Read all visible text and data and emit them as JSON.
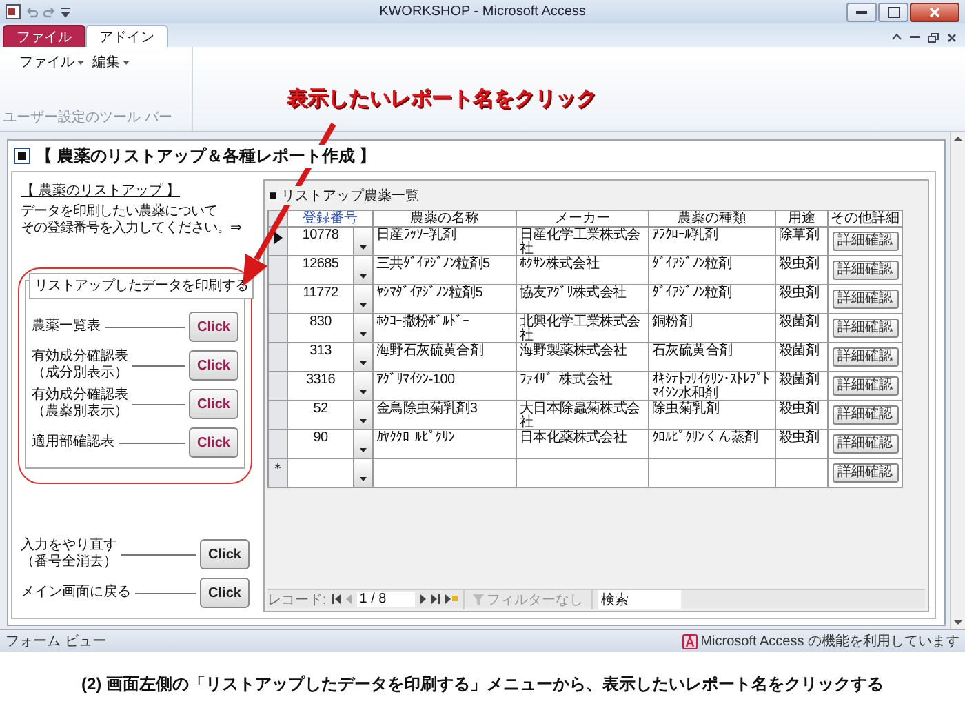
{
  "window": {
    "title": "KWORKSHOP - Microsoft Access"
  },
  "ribbon": {
    "tabs": [
      {
        "label": "ファイル",
        "kind": "file",
        "selected": false
      },
      {
        "label": "アドイン",
        "kind": "tab",
        "selected": true
      }
    ],
    "menus": [
      "ファイル",
      "編集"
    ],
    "group_label": "ユーザー設定のツール バー"
  },
  "annotation": {
    "callout": "表示したいレポート名をクリック"
  },
  "form": {
    "title": "【 農薬のリストアップ＆各種レポート作成 】",
    "left_panel": {
      "heading": "【 農薬のリストアップ 】",
      "instructions": [
        "データを印刷したい農薬について",
        "その登録番号を入力してください。⇒"
      ],
      "print_group": {
        "legend": "リストアップしたデータを印刷する",
        "reports": [
          {
            "label": [
              "農薬一覧表"
            ],
            "button": "Click"
          },
          {
            "label": [
              "有効成分確認表",
              "（成分別表示）"
            ],
            "button": "Click"
          },
          {
            "label": [
              "有効成分確認表",
              "（農薬別表示）"
            ],
            "button": "Click"
          },
          {
            "label": [
              "適用部確認表"
            ],
            "button": "Click"
          }
        ]
      },
      "actions": [
        {
          "label": [
            "入力をやり直す",
            "（番号全消去）"
          ],
          "button": "Click"
        },
        {
          "label": [
            "メイン画面に戻る"
          ],
          "button": "Click"
        }
      ]
    },
    "subform": {
      "title": "■ リストアップ農薬一覧",
      "columns": [
        "登録番号",
        "農薬の名称",
        "メーカー",
        "農薬の種類",
        "用途",
        "その他詳細"
      ],
      "rows": [
        {
          "current": true,
          "cells": [
            "10778",
            "日産ﾗｯｿｰ乳剤",
            "日産化学工業株式会社",
            "ｱﾗｸﾛｰﾙ乳剤",
            "除草剤"
          ],
          "button": "詳細確認"
        },
        {
          "current": false,
          "cells": [
            "12685",
            "三共ﾀﾞｲｱｼﾞﾉﾝ粒剤5",
            "ﾎｸｻﾝ株式会社",
            "ﾀﾞｲｱｼﾞﾉﾝ粒剤",
            "殺虫剤"
          ],
          "button": "詳細確認"
        },
        {
          "current": false,
          "cells": [
            "11772",
            "ﾔｼﾏﾀﾞｲｱｼﾞﾉﾝ粒剤5",
            "協友ｱｸﾞﾘ株式会社",
            "ﾀﾞｲｱｼﾞﾉﾝ粒剤",
            "殺虫剤"
          ],
          "button": "詳細確認"
        },
        {
          "current": false,
          "cells": [
            "830",
            "ﾎｸｺｰ撒粉ﾎﾞﾙﾄﾞｰ",
            "北興化学工業株式会社",
            "銅粉剤",
            "殺菌剤"
          ],
          "button": "詳細確認"
        },
        {
          "current": false,
          "cells": [
            "313",
            "海野石灰硫黄合剤",
            "海野製薬株式会社",
            "石灰硫黄合剤",
            "殺菌剤"
          ],
          "button": "詳細確認"
        },
        {
          "current": false,
          "cells": [
            "3316",
            "ｱｸﾞﾘﾏｲｼﾝ-100",
            "ﾌｧｲｻﾞｰ株式会社",
            "ｵｷｼﾃﾄﾗｻｲｸﾘﾝ･ｽﾄﾚﾌﾟﾄﾏｲｼﾝ水和剤",
            "殺菌剤"
          ],
          "button": "詳細確認"
        },
        {
          "current": false,
          "cells": [
            "52",
            "金鳥除虫菊乳剤3",
            "大日本除蟲菊株式会社",
            "除虫菊乳剤",
            "殺虫剤"
          ],
          "button": "詳細確認"
        },
        {
          "current": false,
          "cells": [
            "90",
            "ｶﾔｸｸﾛｰﾙﾋﾟｸﾘﾝ",
            "日本化薬株式会社",
            "ｸﾛﾙﾋﾟｸﾘﾝくん蒸剤",
            "殺虫剤"
          ],
          "button": "詳細確認"
        }
      ],
      "new_row": {
        "marker": "＊",
        "button": "詳細確認"
      },
      "navigation": {
        "label": "レコード:",
        "position": "1 / 8",
        "filter": "フィルターなし",
        "search": "検索"
      }
    }
  },
  "status_bar": {
    "left": "フォーム ビュー",
    "right": "Microsoft Access の機能を利用しています"
  },
  "caption": "(2) 画面左側の「リストアップしたデータを印刷する」メニューから、表示したいレポート名をクリックする"
}
